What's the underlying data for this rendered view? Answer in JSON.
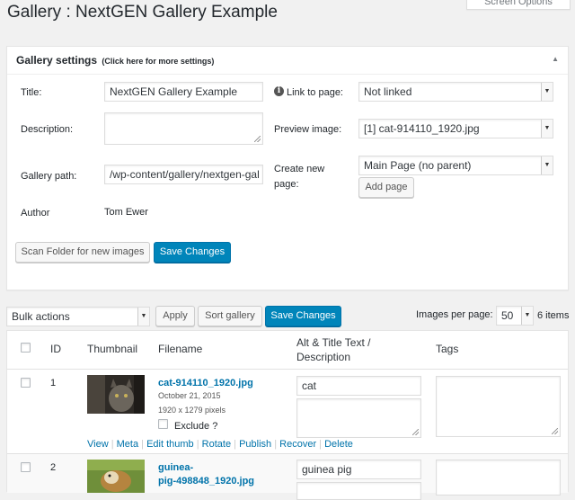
{
  "page": {
    "title": "Gallery : NextGEN Gallery Example",
    "screen_options": "Screen Options"
  },
  "settings": {
    "title": "Gallery settings",
    "title_hint": "(Click here for more settings)",
    "labels": {
      "title": "Title:",
      "description": "Description:",
      "gallery_path": "Gallery path:",
      "author": "Author",
      "link_to_page": "Link to page:",
      "preview_image": "Preview image:",
      "create_new_page_1": "Create new",
      "create_new_page_2": "page:"
    },
    "values": {
      "title": "NextGEN Gallery Example",
      "description": "",
      "gallery_path": "/wp-content/gallery/nextgen-gal",
      "author": "Tom Ewer",
      "link_to_page": "Not linked",
      "preview_image": "[1] cat-914110_1920.jpg",
      "create_new_page": "Main Page (no parent)"
    },
    "buttons": {
      "add_page": "Add page",
      "scan_folder": "Scan Folder for new images",
      "save_changes": "Save Changes"
    }
  },
  "toolbar": {
    "bulk_actions": "Bulk actions",
    "apply": "Apply",
    "sort_gallery": "Sort gallery",
    "save_changes": "Save Changes",
    "images_per_page_label": "Images per page:",
    "images_per_page_value": "50",
    "item_count": "6 items"
  },
  "table": {
    "headers": {
      "id": "ID",
      "thumbnail": "Thumbnail",
      "filename": "Filename",
      "alt_title_1": "Alt & Title Text /",
      "alt_title_2": "Description",
      "tags": "Tags"
    },
    "rows": [
      {
        "id": "1",
        "filename": "cat-914110_1920.jpg",
        "date": "October 21, 2015",
        "dimensions": "1920 x 1279 pixels",
        "exclude_label": "Exclude ?",
        "alt_text": "cat",
        "actions": [
          "View",
          "Meta",
          "Edit thumb",
          "Rotate",
          "Publish",
          "Recover",
          "Delete"
        ]
      },
      {
        "id": "2",
        "filename_1": "guinea-",
        "filename_2": "pig-498848_1920.jpg",
        "alt_text": "guinea pig"
      }
    ]
  },
  "colors": {
    "primary": "#0085ba",
    "link": "#0073aa",
    "background": "#f1f1f1"
  }
}
